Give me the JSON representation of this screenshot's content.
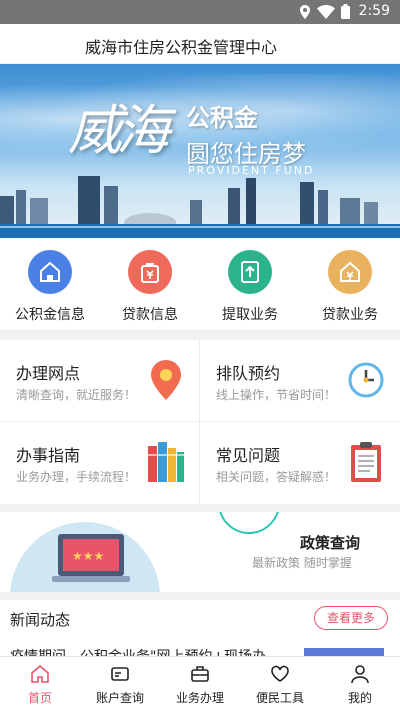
{
  "status_bar": {
    "time": "2:59"
  },
  "header": {
    "title": "威海市住房公积金管理中心"
  },
  "banner": {
    "calligraphy": "威海",
    "line1": "公积金",
    "line2": "圆您住房梦",
    "line3": "PROVIDENT FUND"
  },
  "quick_grid": [
    {
      "label": "公积金信息",
      "icon": "house-icon",
      "color": "#4a7fe6"
    },
    {
      "label": "贷款信息",
      "icon": "loan-bag-icon",
      "color": "#f06a5c"
    },
    {
      "label": "提取业务",
      "icon": "withdraw-icon",
      "color": "#2cb38c"
    },
    {
      "label": "贷款业务",
      "icon": "house-yen-icon",
      "color": "#e9b25e"
    }
  ],
  "services": [
    {
      "title": "办理网点",
      "desc": "清晰查询，就近服务！",
      "icon": "location-pin-icon"
    },
    {
      "title": "排队预约",
      "desc": "线上操作，节省时间！",
      "icon": "clock-icon"
    },
    {
      "title": "办事指南",
      "desc": "业务办理，手续流程！",
      "icon": "books-icon"
    },
    {
      "title": "常见问题",
      "desc": "相关问题，答疑解惑！",
      "icon": "clipboard-icon"
    }
  ],
  "policy": {
    "title": "政策查询",
    "desc": "最新政策 随时掌握"
  },
  "news": {
    "heading": "新闻动态",
    "more": "查看更多",
    "first_item": "疫情期间，公积金业务\"网上预约+现场办"
  },
  "tabbar": [
    {
      "label": "首页",
      "icon": "home-icon",
      "active": true
    },
    {
      "label": "账户查询",
      "icon": "card-icon",
      "active": false
    },
    {
      "label": "业务办理",
      "icon": "briefcase-icon",
      "active": false
    },
    {
      "label": "便民工具",
      "icon": "heart-icon",
      "active": false
    },
    {
      "label": "我的",
      "icon": "user-icon",
      "active": false
    }
  ],
  "colors": {
    "accent": "#e9546b",
    "text": "#222222",
    "muted": "#999999"
  }
}
